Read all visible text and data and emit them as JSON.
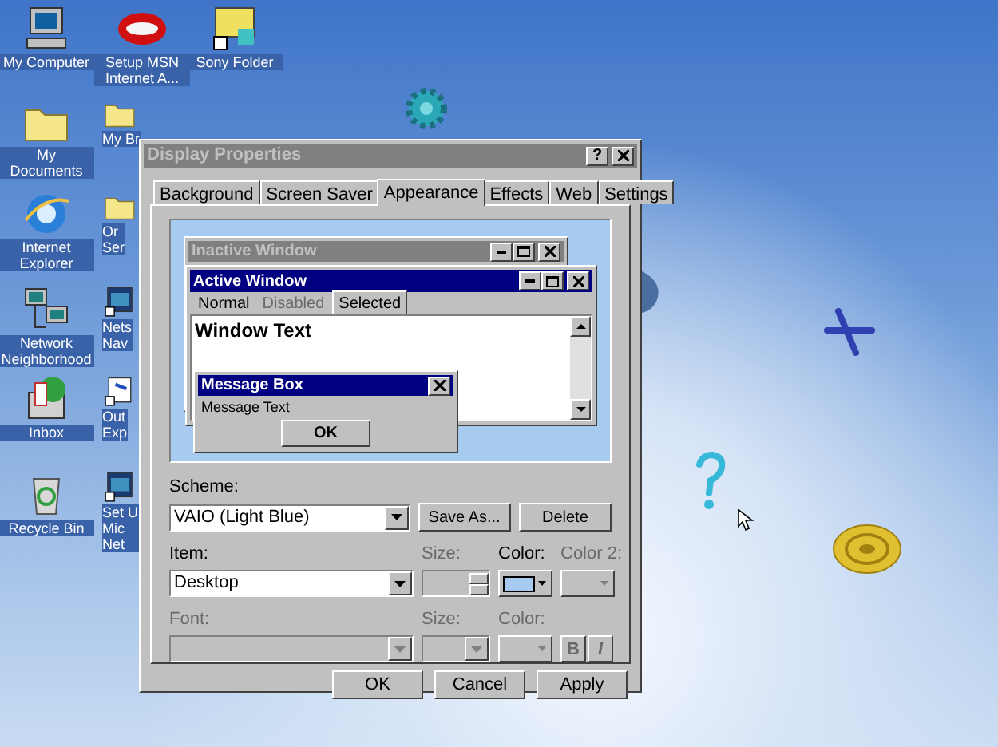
{
  "desktop_icons": [
    {
      "label": "My Computer",
      "kind": "computer"
    },
    {
      "label": "Setup MSN Internet A...",
      "kind": "msn"
    },
    {
      "label": "Sony Folder",
      "kind": "sony"
    },
    {
      "label": "My Documents",
      "kind": "folder_docs"
    },
    {
      "label": "My Br",
      "kind": "folder"
    },
    {
      "label": "Internet Explorer",
      "kind": "ie"
    },
    {
      "label": "Or\nSer",
      "kind": "folder"
    },
    {
      "label": "Network Neighborhood",
      "kind": "network"
    },
    {
      "label": "Nets\nNav",
      "kind": "app"
    },
    {
      "label": "Inbox",
      "kind": "inbox"
    },
    {
      "label": "Out\nExp",
      "kind": "mail"
    },
    {
      "label": "Recycle Bin",
      "kind": "recycle"
    },
    {
      "label": "Set U\nMic\nNet",
      "kind": "app"
    }
  ],
  "dialog": {
    "title": "Display Properties",
    "help_button": "?",
    "active": false
  },
  "tabs": [
    {
      "label": "Background",
      "selected": false
    },
    {
      "label": "Screen Saver",
      "selected": false
    },
    {
      "label": "Appearance",
      "selected": true
    },
    {
      "label": "Effects",
      "selected": false
    },
    {
      "label": "Web",
      "selected": false
    },
    {
      "label": "Settings",
      "selected": false
    }
  ],
  "preview": {
    "inactive_title": "Inactive Window",
    "active_title": "Active Window",
    "menu": [
      {
        "label": "Normal",
        "disabled": false,
        "selected": false
      },
      {
        "label": "Disabled",
        "disabled": true,
        "selected": false
      },
      {
        "label": "Selected",
        "disabled": false,
        "selected": true
      }
    ],
    "window_text": "Window Text",
    "message_box": {
      "title": "Message Box",
      "text": "Message Text",
      "button": "OK"
    }
  },
  "scheme": {
    "label": "Scheme:",
    "value": "VAIO (Light Blue)",
    "buttons": [
      "Save As...",
      "Delete"
    ]
  },
  "item_row": [
    {
      "kind": "combo",
      "label": "Item:",
      "value": "Desktop",
      "disabled": false
    },
    {
      "kind": "spinner",
      "label": "Size:",
      "disabled": true
    },
    {
      "kind": "color",
      "label": "Color:",
      "disabled": false,
      "color": "#a6caf0"
    },
    {
      "kind": "color",
      "label": "Color 2:",
      "disabled": true
    }
  ],
  "font_row": [
    {
      "kind": "combo",
      "label": "Font:",
      "disabled": true
    },
    {
      "kind": "small_combo",
      "label": "Size:",
      "disabled": true
    },
    {
      "kind": "color",
      "label": "Color:",
      "disabled": true
    },
    {
      "kind": "toggles",
      "buttons": [
        "B",
        "I"
      ],
      "disabled": true
    }
  ],
  "footer_buttons": [
    {
      "label": "OK",
      "disabled": false
    },
    {
      "label": "Cancel",
      "disabled": false
    },
    {
      "label": "Apply",
      "disabled": false
    }
  ]
}
